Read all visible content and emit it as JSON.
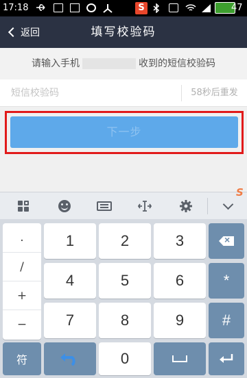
{
  "status_bar": {
    "time": "17:18",
    "sogou_badge": "S",
    "battery": "47"
  },
  "nav": {
    "back_label": "返回",
    "title": "填写校验码"
  },
  "hint": {
    "prefix": "请输入手机",
    "suffix": "收到的短信校验码"
  },
  "code_input": {
    "placeholder": "短信校验码",
    "value": ""
  },
  "resend": "58秒后重发",
  "next_button": "下一步",
  "keyboard": {
    "brand_mark": "S",
    "symbols": [
      ".",
      "/",
      "+",
      "−"
    ],
    "digits": [
      "1",
      "2",
      "3",
      "4",
      "5",
      "6",
      "7",
      "8",
      "9",
      "0"
    ],
    "right_keys": [
      "*",
      "#"
    ],
    "symbol_switch": "符"
  },
  "colors": {
    "nav_bg": "#2b3243",
    "next_button": "#5ea9ea",
    "highlight_border": "#e11a1a",
    "keyboard_accent": "#6e8ead"
  }
}
